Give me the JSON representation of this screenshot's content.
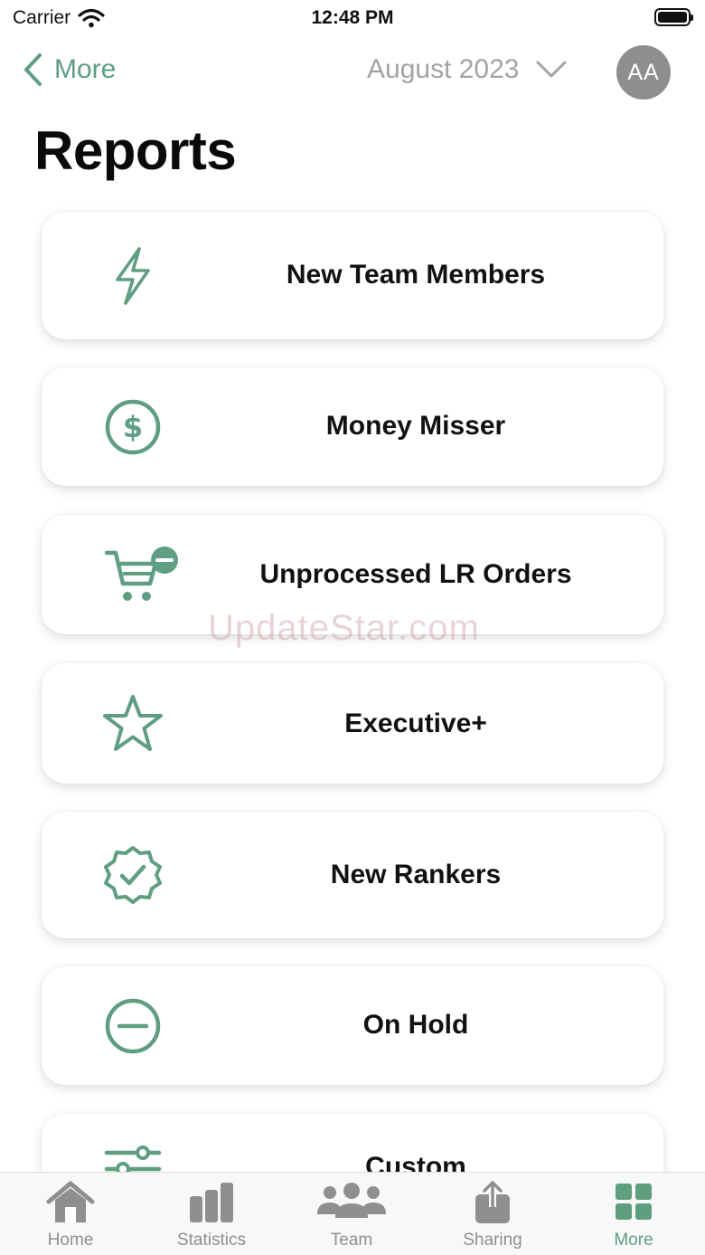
{
  "status_bar": {
    "carrier": "Carrier",
    "time": "12:48 PM"
  },
  "nav": {
    "back_label": "More",
    "month": "August 2023",
    "avatar_initials": "AA"
  },
  "page": {
    "title": "Reports"
  },
  "reports": [
    {
      "label": "New Team Members",
      "icon": "lightning-icon"
    },
    {
      "label": "Money Misser",
      "icon": "dollar-circle-icon"
    },
    {
      "label": "Unprocessed LR Orders",
      "icon": "cart-minus-icon"
    },
    {
      "label": "Executive+",
      "icon": "star-icon"
    },
    {
      "label": "New Rankers",
      "icon": "badge-check-icon"
    },
    {
      "label": "On Hold",
      "icon": "minus-circle-icon"
    },
    {
      "label": "Custom",
      "icon": "sliders-icon"
    }
  ],
  "watermark": "UpdateStar.com",
  "tabs": [
    {
      "label": "Home",
      "icon": "home-icon",
      "active": false
    },
    {
      "label": "Statistics",
      "icon": "bar-chart-icon",
      "active": false
    },
    {
      "label": "Team",
      "icon": "team-icon",
      "active": false
    },
    {
      "label": "Sharing",
      "icon": "share-icon",
      "active": false
    },
    {
      "label": "More",
      "icon": "grid-icon",
      "active": true
    }
  ],
  "colors": {
    "accent": "#5f9e80",
    "inactive_tab": "#8f8f8f",
    "avatar_bg": "#8e8e8e"
  }
}
